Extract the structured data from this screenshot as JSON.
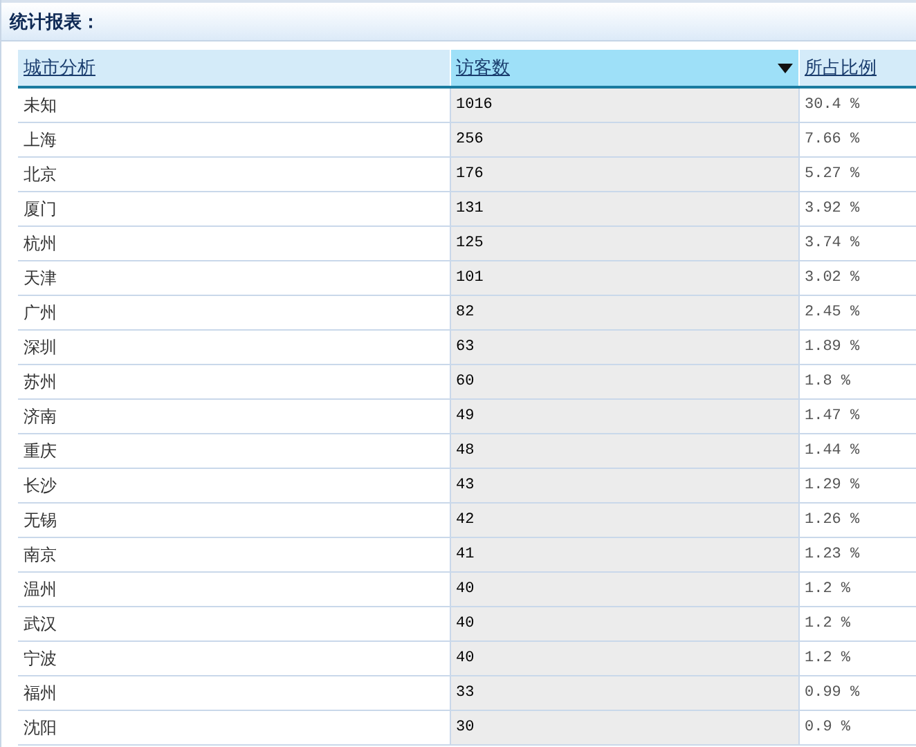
{
  "title": "统计报表：",
  "table": {
    "columns": [
      {
        "label": "城市分析",
        "selected": false
      },
      {
        "label": "访客数",
        "selected": true
      },
      {
        "label": "所占比例",
        "selected": false
      }
    ],
    "rows": [
      [
        "未知",
        "1016",
        "30.4 %"
      ],
      [
        "上海",
        "256",
        "7.66 %"
      ],
      [
        "北京",
        "176",
        "5.27 %"
      ],
      [
        "厦门",
        "131",
        "3.92 %"
      ],
      [
        "杭州",
        "125",
        "3.74 %"
      ],
      [
        "天津",
        "101",
        "3.02 %"
      ],
      [
        "广州",
        "82",
        "2.45 %"
      ],
      [
        "深圳",
        "63",
        "1.89 %"
      ],
      [
        "苏州",
        "60",
        "1.8 %"
      ],
      [
        "济南",
        "49",
        "1.47 %"
      ],
      [
        "重庆",
        "48",
        "1.44 %"
      ],
      [
        "长沙",
        "43",
        "1.29 %"
      ],
      [
        "无锡",
        "42",
        "1.26 %"
      ],
      [
        "南京",
        "41",
        "1.23 %"
      ],
      [
        "温州",
        "40",
        "1.2 %"
      ],
      [
        "武汉",
        "40",
        "1.2 %"
      ],
      [
        "宁波",
        "40",
        "1.2 %"
      ],
      [
        "福州",
        "33",
        "0.99 %"
      ],
      [
        "沈阳",
        "30",
        "0.9 %"
      ]
    ]
  }
}
